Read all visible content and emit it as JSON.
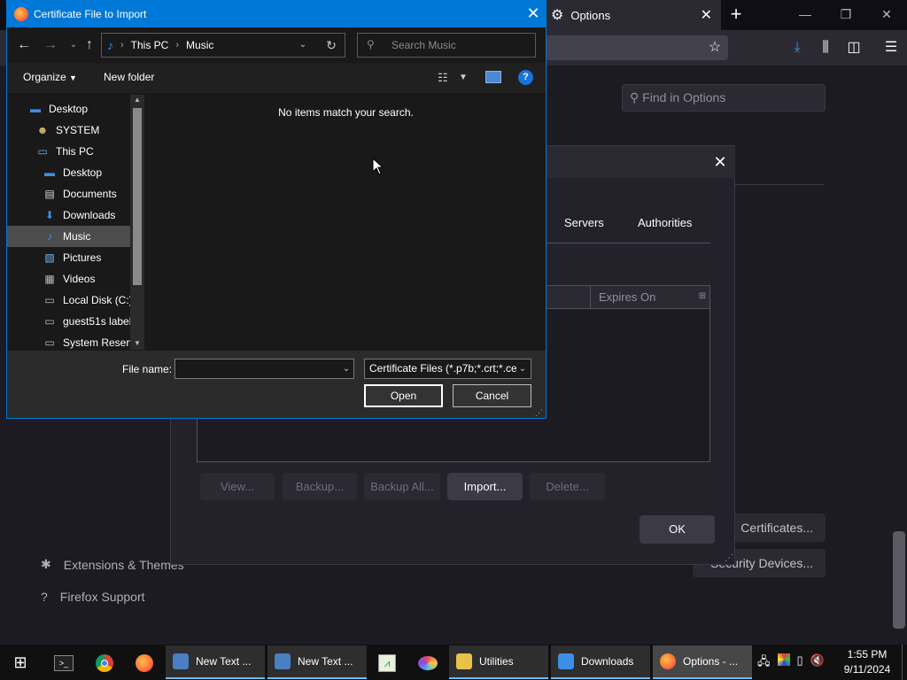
{
  "firefox": {
    "tab_title": "Options",
    "find_placeholder": "Find in Options",
    "sidebar": {
      "extensions": "Extensions & Themes",
      "support": "Firefox Support"
    },
    "buttons": {
      "certificates": "Certificates...",
      "security_devices": "Security Devices..."
    }
  },
  "cert_manager": {
    "tabs": [
      "Servers",
      "Authorities"
    ],
    "column": "Expires On",
    "buttons": [
      "View...",
      "Backup...",
      "Backup All...",
      "Import...",
      "Delete..."
    ],
    "ok": "OK"
  },
  "file_dialog": {
    "title": "Certificate File to Import",
    "path": [
      "This PC",
      "Music"
    ],
    "search_placeholder": "Search Music",
    "organize": "Organize",
    "new_folder": "New folder",
    "empty_message": "No items match your search.",
    "tree": [
      {
        "label": "Desktop",
        "icon": "desktop-icon",
        "indent": 0,
        "color": "#3d8ee6"
      },
      {
        "label": "SYSTEM",
        "icon": "user-icon",
        "indent": 1,
        "color": "#d6b87a"
      },
      {
        "label": "This PC",
        "icon": "computer-icon",
        "indent": 1,
        "color": "#6fb3e8"
      },
      {
        "label": "Desktop",
        "icon": "desktop-icon",
        "indent": 2,
        "color": "#3d8ee6"
      },
      {
        "label": "Documents",
        "icon": "document-icon",
        "indent": 2,
        "color": "#d8d8d8"
      },
      {
        "label": "Downloads",
        "icon": "download-icon",
        "indent": 2,
        "color": "#3d8ee6"
      },
      {
        "label": "Music",
        "icon": "music-icon",
        "indent": 2,
        "color": "#3d8ee6",
        "selected": true
      },
      {
        "label": "Pictures",
        "icon": "pictures-icon",
        "indent": 2,
        "color": "#7fb8e8"
      },
      {
        "label": "Videos",
        "icon": "videos-icon",
        "indent": 2,
        "color": "#bbbbbb"
      },
      {
        "label": "Local Disk (C:)",
        "icon": "drive-icon",
        "indent": 2,
        "color": "#bbbbbb"
      },
      {
        "label": "guest51s label",
        "icon": "drive-icon",
        "indent": 2,
        "color": "#bbbbbb"
      },
      {
        "label": "System Reserve",
        "icon": "drive-icon",
        "indent": 2,
        "color": "#bbbbbb"
      }
    ],
    "file_name_label": "File name:",
    "file_name_value": "",
    "filter": "Certificate Files (*.p7b;*.crt;*.ce",
    "open": "Open",
    "cancel": "Cancel"
  },
  "taskbar": {
    "windows": [
      {
        "label": "New Text ...",
        "color": "#4a7fc1"
      },
      {
        "label": "New Text ...",
        "color": "#4a7fc1"
      },
      {
        "label": "Utilities",
        "color": "#e8c14a"
      },
      {
        "label": "Downloads",
        "color": "#3d8ee6"
      },
      {
        "label": "Options - ...",
        "color": "#ff7139"
      }
    ],
    "clock_time": "1:55 PM",
    "clock_date": "9/11/2024"
  }
}
